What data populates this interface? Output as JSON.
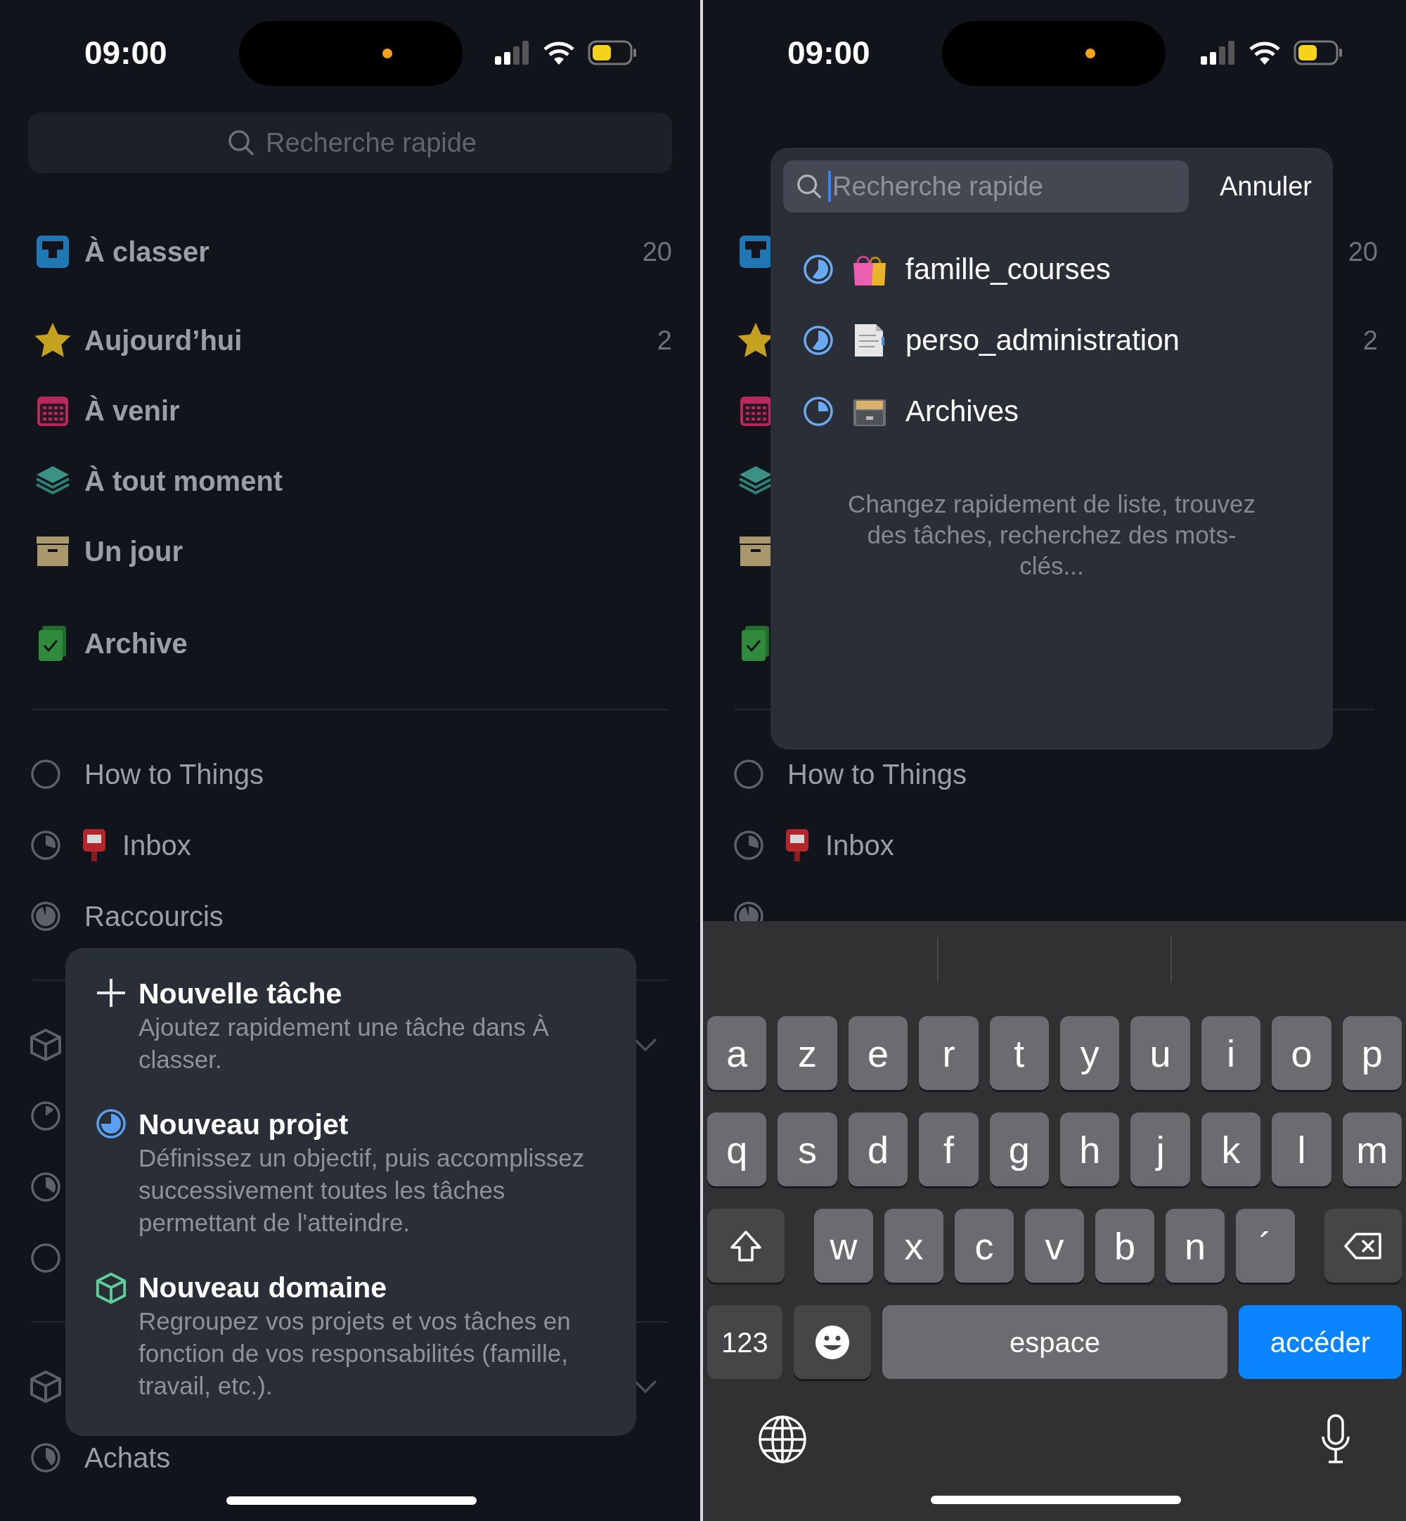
{
  "left_screen": {
    "status_bar": {
      "time": "09:00"
    },
    "search": {
      "placeholder": "Recherche rapide"
    },
    "sections": [
      [
        {
          "kind": "inbox",
          "label": "À classer",
          "count": "20"
        }
      ],
      [
        {
          "kind": "star",
          "label": "Aujourd’hui",
          "count": "2"
        },
        {
          "kind": "calendar",
          "label": "À venir"
        },
        {
          "kind": "layers",
          "label": "À tout moment"
        },
        {
          "kind": "box",
          "label": "Un jour"
        }
      ],
      [
        {
          "kind": "logbook",
          "label": "Archive"
        }
      ]
    ],
    "projects": [
      {
        "kind": "empty",
        "label": "How to Things"
      },
      {
        "kind": "mailbox",
        "label": "Inbox"
      },
      {
        "kind": "nearly_full",
        "label": "Raccourcis"
      }
    ],
    "areas": [
      {
        "projects": [
          {
            "kind": "sliver"
          },
          {
            "kind": "third"
          },
          {
            "kind": "empty"
          }
        ]
      },
      {
        "projects": [
          {
            "kind": "two_fifths",
            "label": "Achats"
          }
        ]
      }
    ],
    "menu": {
      "items": [
        {
          "kind": "task",
          "title": "Nouvelle tâche",
          "description": "Ajoutez rapidement une tâche dans À classer."
        },
        {
          "kind": "project",
          "title": "Nouveau projet",
          "description": "Définissez un objectif, puis accomplissez successivement toutes les tâches permettant de l'atteindre."
        },
        {
          "kind": "area",
          "title": "Nouveau domaine",
          "description": "Regroupez vos projets et vos tâches en fonction de vos responsabilités (famille, travail, etc.)."
        }
      ]
    }
  },
  "right_screen": {
    "status_bar": {
      "time": "09:00"
    },
    "sections": [
      [
        {
          "kind": "inbox",
          "count": "20"
        }
      ],
      [
        {
          "kind": "star",
          "count": "2"
        },
        {
          "kind": "calendar"
        },
        {
          "kind": "layers"
        },
        {
          "kind": "box"
        }
      ],
      [
        {
          "kind": "logbook"
        }
      ]
    ],
    "projects": [
      {
        "kind": "empty",
        "label": "How to Things"
      },
      {
        "kind": "mailbox",
        "label": "Inbox"
      },
      {
        "kind": "nearly_full"
      }
    ],
    "quick_search": {
      "placeholder": "Recherche rapide",
      "cancel": "Annuler",
      "results": [
        {
          "kind": "shopping_bags",
          "label": "famille_courses"
        },
        {
          "kind": "document",
          "label": "perso_administration"
        },
        {
          "kind": "file_cabinet",
          "label": "Archives"
        }
      ],
      "hint": "Changez rapidement de liste, trouvez des tâches, recherchez des mots-clés..."
    },
    "keyboard": {
      "rows": [
        [
          "a",
          "z",
          "e",
          "r",
          "t",
          "y",
          "u",
          "i",
          "o",
          "p"
        ],
        [
          "q",
          "s",
          "d",
          "f",
          "g",
          "h",
          "j",
          "k",
          "l",
          "m"
        ],
        [
          "w",
          "x",
          "c",
          "v",
          "b",
          "n",
          "´"
        ]
      ],
      "numbers_key": "123",
      "space_key": "espace",
      "go_key": "accéder"
    }
  }
}
